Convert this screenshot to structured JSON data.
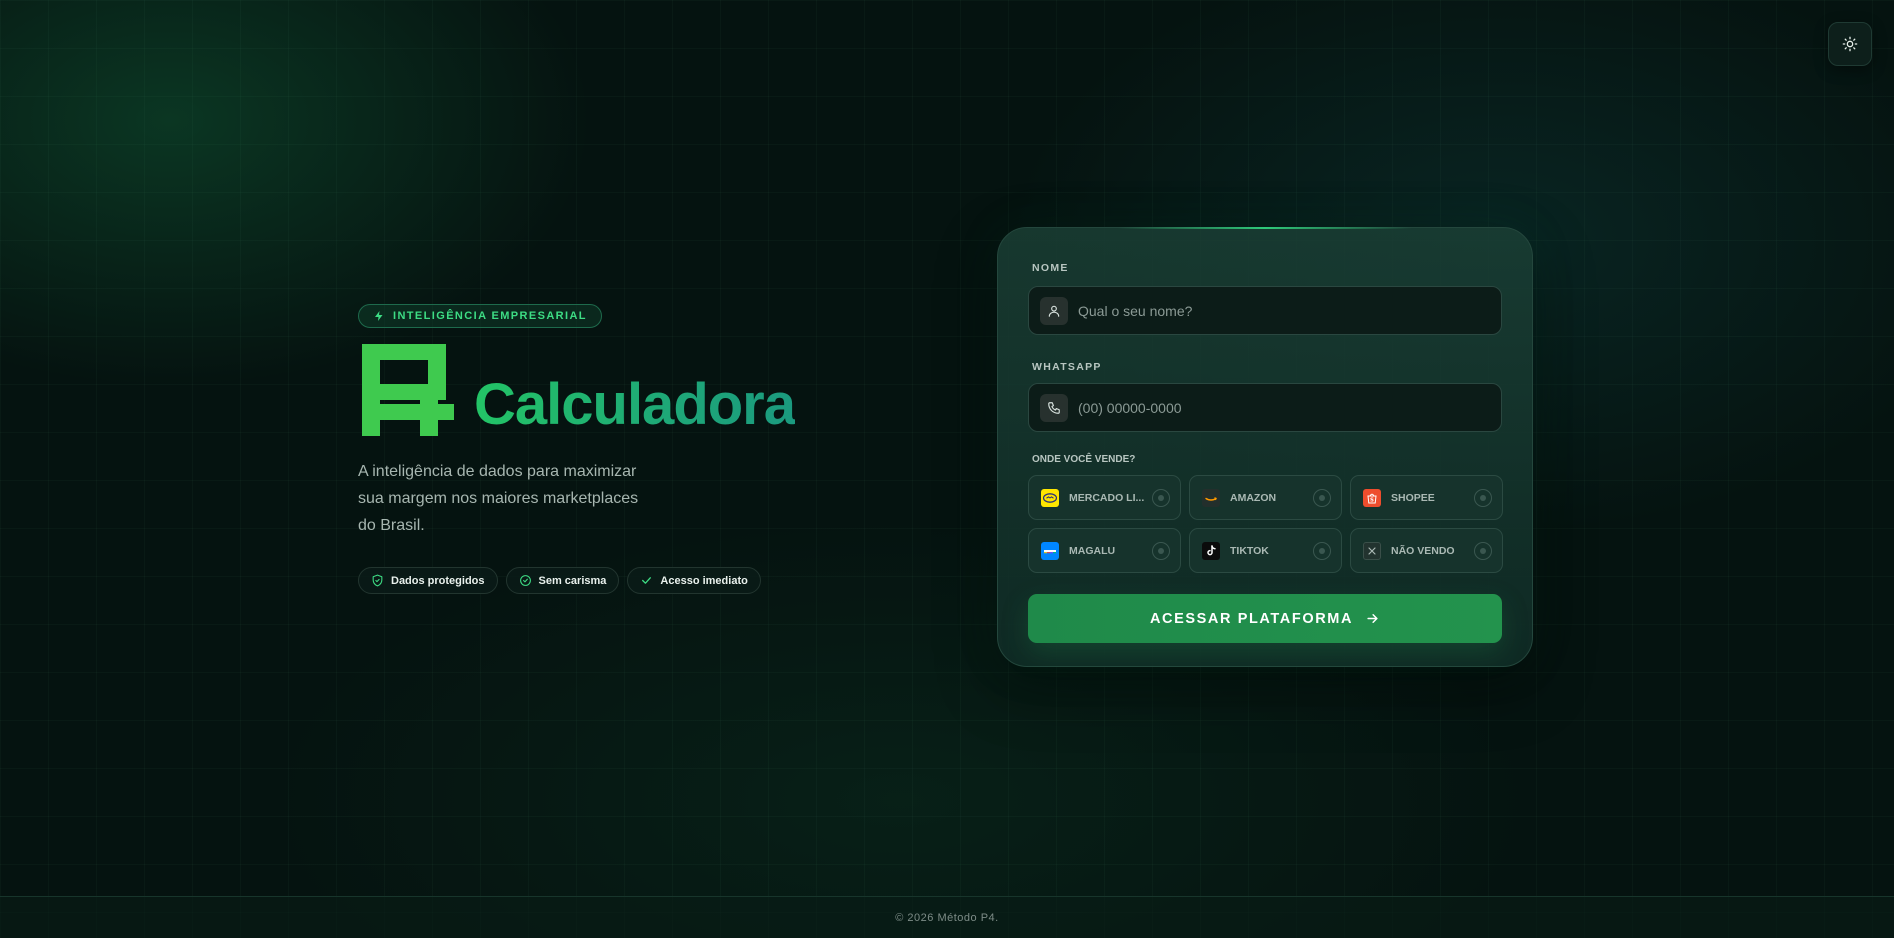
{
  "hero": {
    "badge": "INTELIGÊNCIA EMPRESARIAL",
    "brand_name": "Calculadora",
    "tagline": "A inteligência de dados para maximizar sua margem nos maiores marketplaces do Brasil.",
    "chips": [
      {
        "label": "Dados protegidos",
        "icon": "shield-check-icon"
      },
      {
        "label": "Sem carisma",
        "icon": "circle-check-icon"
      },
      {
        "label": "Acesso imediato",
        "icon": "check-icon"
      }
    ]
  },
  "form": {
    "name_label": "NOME",
    "name_placeholder": "Qual o seu nome?",
    "name_value": "",
    "whatsapp_label": "WHATSAPP",
    "whatsapp_placeholder": "(00) 00000-0000",
    "whatsapp_value": "",
    "marketplaces_label": "ONDE VOCÊ VENDE?",
    "marketplaces": [
      {
        "name": "MERCADO LI...",
        "icon": "mercado-livre-logo",
        "selected": false
      },
      {
        "name": "AMAZON",
        "icon": "amazon-logo",
        "selected": false
      },
      {
        "name": "SHOPEE",
        "icon": "shopee-logo",
        "selected": false
      },
      {
        "name": "MAGALU",
        "icon": "magalu-logo",
        "selected": false
      },
      {
        "name": "TIKTOK",
        "icon": "tiktok-logo",
        "selected": false
      },
      {
        "name": "NÃO VENDO",
        "icon": "x-icon",
        "selected": false
      }
    ],
    "submit_label": "ACESSAR PLATAFORMA"
  },
  "footer": {
    "text": "© 2026 Método P4."
  },
  "colors": {
    "accent": "#23c466",
    "button": "#1f8a4a",
    "background": "#051310",
    "mercado_livre": "#ffe600",
    "shopee": "#ee4d2d",
    "magalu": "#0086ff"
  }
}
